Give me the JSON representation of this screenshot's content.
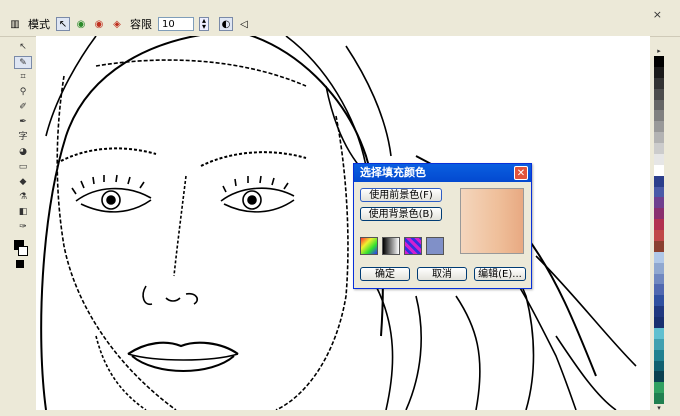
{
  "window": {
    "close_glyph": "×"
  },
  "property_bar": {
    "mode_label": "模式",
    "tolerance_label": "容限",
    "tolerance_value": "10"
  },
  "tools": [
    "pick-tool",
    "shape-tool",
    "crop-tool",
    "zoom-tool",
    "freehand-tool",
    "smart-fill-tool",
    "text-tool",
    "interactive-tool",
    "rectangle-tool",
    "fill-tool",
    "eyedropper-tool",
    "outline-tool",
    "interactive-fill-tool"
  ],
  "palette": {
    "colors": [
      "#000000",
      "#1a1a1a",
      "#333333",
      "#4d4d4d",
      "#666666",
      "#808080",
      "#999999",
      "#b3b3b3",
      "#cccccc",
      "#e6e6e6",
      "#ffffff",
      "#2b3e8c",
      "#4a5aa8",
      "#6f3f8f",
      "#8a2f6e",
      "#b23050",
      "#c04848",
      "#8a4030",
      "#b0c8e8",
      "#90a8d0",
      "#7088c0",
      "#5068b0",
      "#3050a0",
      "#203880",
      "#183070",
      "#60c0d0",
      "#40a0b0",
      "#208090",
      "#106070",
      "#0a4050",
      "#30a060",
      "#208050"
    ]
  },
  "dialog": {
    "title": "选择填充颜色",
    "close_glyph": "✕",
    "use_foreground": "使用前景色(F)",
    "use_background": "使用背景色(B)",
    "ok": "确定",
    "cancel": "取消",
    "edit": "编辑(E)...",
    "preview_gradient": [
      "#f4d6bd",
      "#efbf9a",
      "#e8a982"
    ]
  }
}
